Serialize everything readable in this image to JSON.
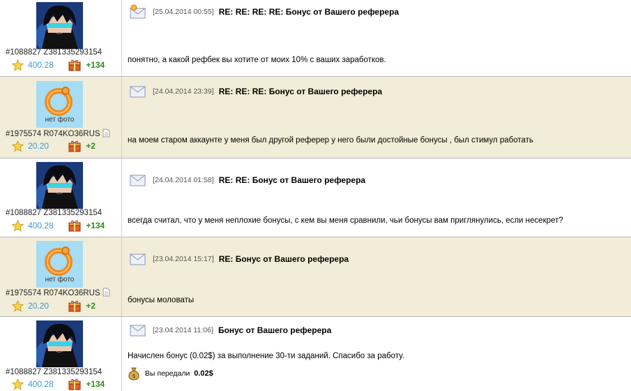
{
  "posts": [
    {
      "user_id": "#1088827 Z381335293154",
      "rating": "400.28",
      "karma": "+134",
      "date": "[25.04.2014 00:55]",
      "subject": "RE: RE: RE: RE: Бонус от Вашего реферера",
      "body": "понятно, а какой рефбек вы хотите от моих 10% с ваших заработков."
    },
    {
      "user_id": "#1975574 R074KO36RUS",
      "rating": "20.20",
      "karma": "+2",
      "nophoto": "нет фото",
      "date": "[24.04.2014 23:39]",
      "subject": "RE: RE: RE: Бонус от Вашего реферера",
      "body": "на моем старом аккаунте у меня был другой реферер у него были достойные бонусы , был стимул работать"
    },
    {
      "user_id": "#1088827 Z381335293154",
      "rating": "400.28",
      "karma": "+134",
      "date": "[24.04.2014 01:58]",
      "subject": "RE: RE: Бонус от Вашего реферера",
      "body": "всегда считал, что у меня неплохие бонусы, с кем вы меня сравнили, чьи бонусы вам приглянулись, если несекрет?"
    },
    {
      "user_id": "#1975574 R074KO36RUS",
      "rating": "20.20",
      "karma": "+2",
      "nophoto": "нет фото",
      "date": "[23.04.2014 15:17]",
      "subject": "RE: Бонус от Вашего реферера",
      "body": "бонусы моловаты"
    },
    {
      "user_id": "#1088827 Z381335293154",
      "rating": "400.28",
      "karma": "+134",
      "date": "[23.04.2014 11:06]",
      "subject": "Бонус от Вашего реферера",
      "body": "Начислен бонус (0.02$) за выполнение 30-ти заданий. Спасибо за работу.",
      "transfer_label": "Вы передали",
      "transfer_amount": "0.02$"
    }
  ],
  "icons": {
    "envelope": "envelope-icon",
    "star": "star-icon",
    "gift": "gift-box-icon",
    "document": "document-icon",
    "money_bag": "money-bag-icon"
  },
  "colors": {
    "alt_row_bg": "#f2edd8",
    "rating": "#3c9ad0",
    "karma": "#2e8b1e"
  }
}
